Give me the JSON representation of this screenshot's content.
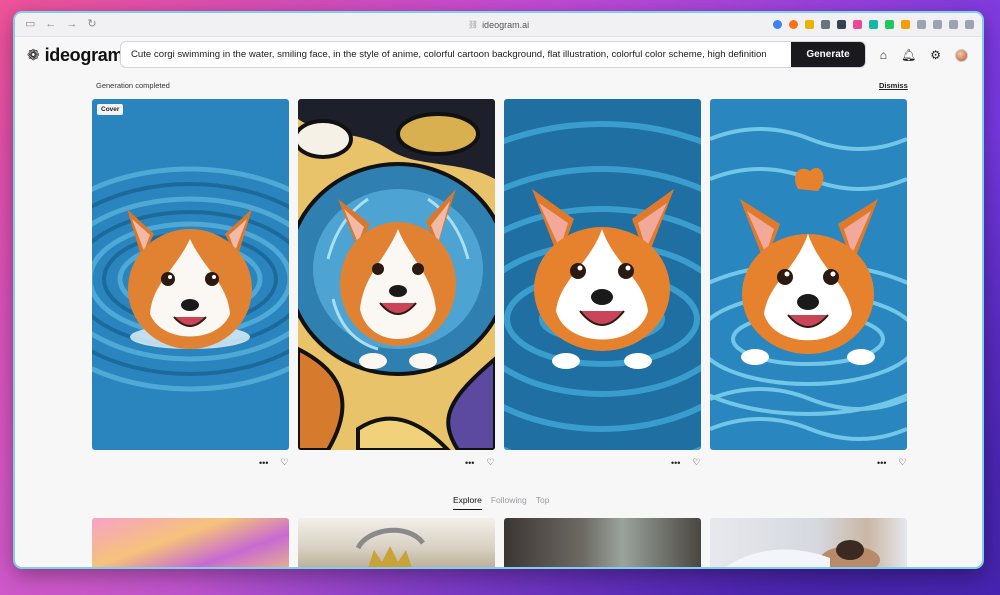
{
  "browser": {
    "url": "ideogram.ai",
    "nav": [
      "sidebar-icon",
      "back-icon",
      "forward-icon",
      "reload-icon"
    ]
  },
  "app": {
    "logo_text": "ideogram",
    "prompt": "Cute corgi swimming in the water, smiling face, in the style of anime, colorful cartoon background, flat illustration, colorful color scheme, high definition",
    "generate_label": "Generate"
  },
  "status": {
    "message": "Generation completed",
    "dismiss": "Dismiss"
  },
  "results": {
    "cover_label": "Cover",
    "more_label": "•••",
    "like_label": "♡"
  },
  "feed_tabs": [
    "Explore",
    "Following",
    "Top"
  ],
  "colors": {
    "accent": "#1a1a1e",
    "water_dark": "#1f6fa3",
    "water_light": "#3aa4d4",
    "corgi_orange": "#e07a2b"
  }
}
